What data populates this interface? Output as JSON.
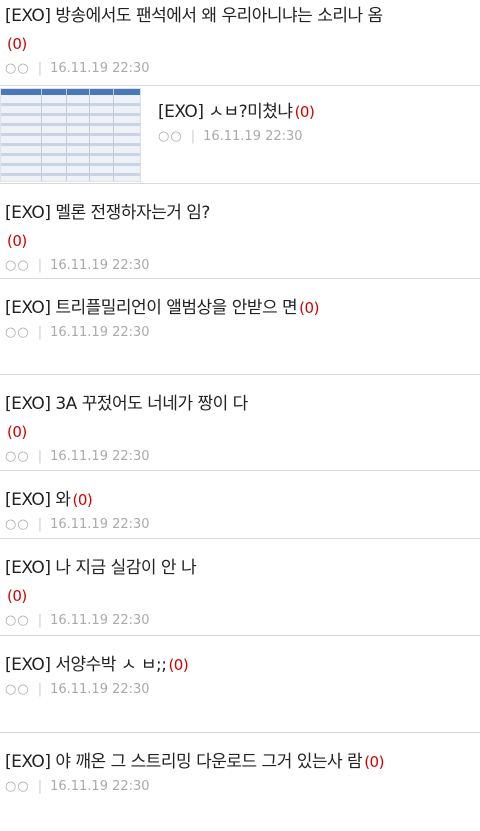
{
  "posts": [
    {
      "title": "[EXO] 방송에서도 팬석에서 왜 우리아니냐는 소리나 옴",
      "count": "(0)",
      "nick": "○○",
      "date": "16.11.19 22:30"
    },
    {
      "title": "[EXO] ㅅㅂ?미쳤냐",
      "count": "(0)",
      "nick": "○○",
      "date": "16.11.19 22:30",
      "thumbnail": "spreadsheet-image"
    },
    {
      "title": "[EXO] 멜론 전쟁하자는거 임?",
      "count": "(0)",
      "nick": "○○",
      "date": "16.11.19 22:30"
    },
    {
      "title": "[EXO] 트리플밀리언이 앨범상을 안받으 면",
      "count": "(0)",
      "nick": "○○",
      "date": "16.11.19 22:30"
    },
    {
      "title": "[EXO] 3A 꾸젔어도 너네가 짱이 다",
      "count": "(0)",
      "nick": "○○",
      "date": "16.11.19 22:30"
    },
    {
      "title": "[EXO] 와",
      "count": "(0)",
      "nick": "○○",
      "date": "16.11.19 22:30"
    },
    {
      "title": "[EXO] 나 지금 실감이 안 나",
      "count": "(0)",
      "nick": "○○",
      "date": "16.11.19 22:30"
    },
    {
      "title": "[EXO] 서양수박 ㅅ ㅂ;;",
      "count": "(0)",
      "nick": "○○",
      "date": "16.11.19 22:30"
    },
    {
      "title": "[EXO] 야 깨온 그 스트리밍 다운로드 그거 있는사 람",
      "count": "(0)",
      "nick": "○○",
      "date": "16.11.19 22:30"
    }
  ],
  "colors": {
    "count": "#d40000",
    "meta": "#aaaaaa",
    "divider": "#d9d9d9"
  }
}
